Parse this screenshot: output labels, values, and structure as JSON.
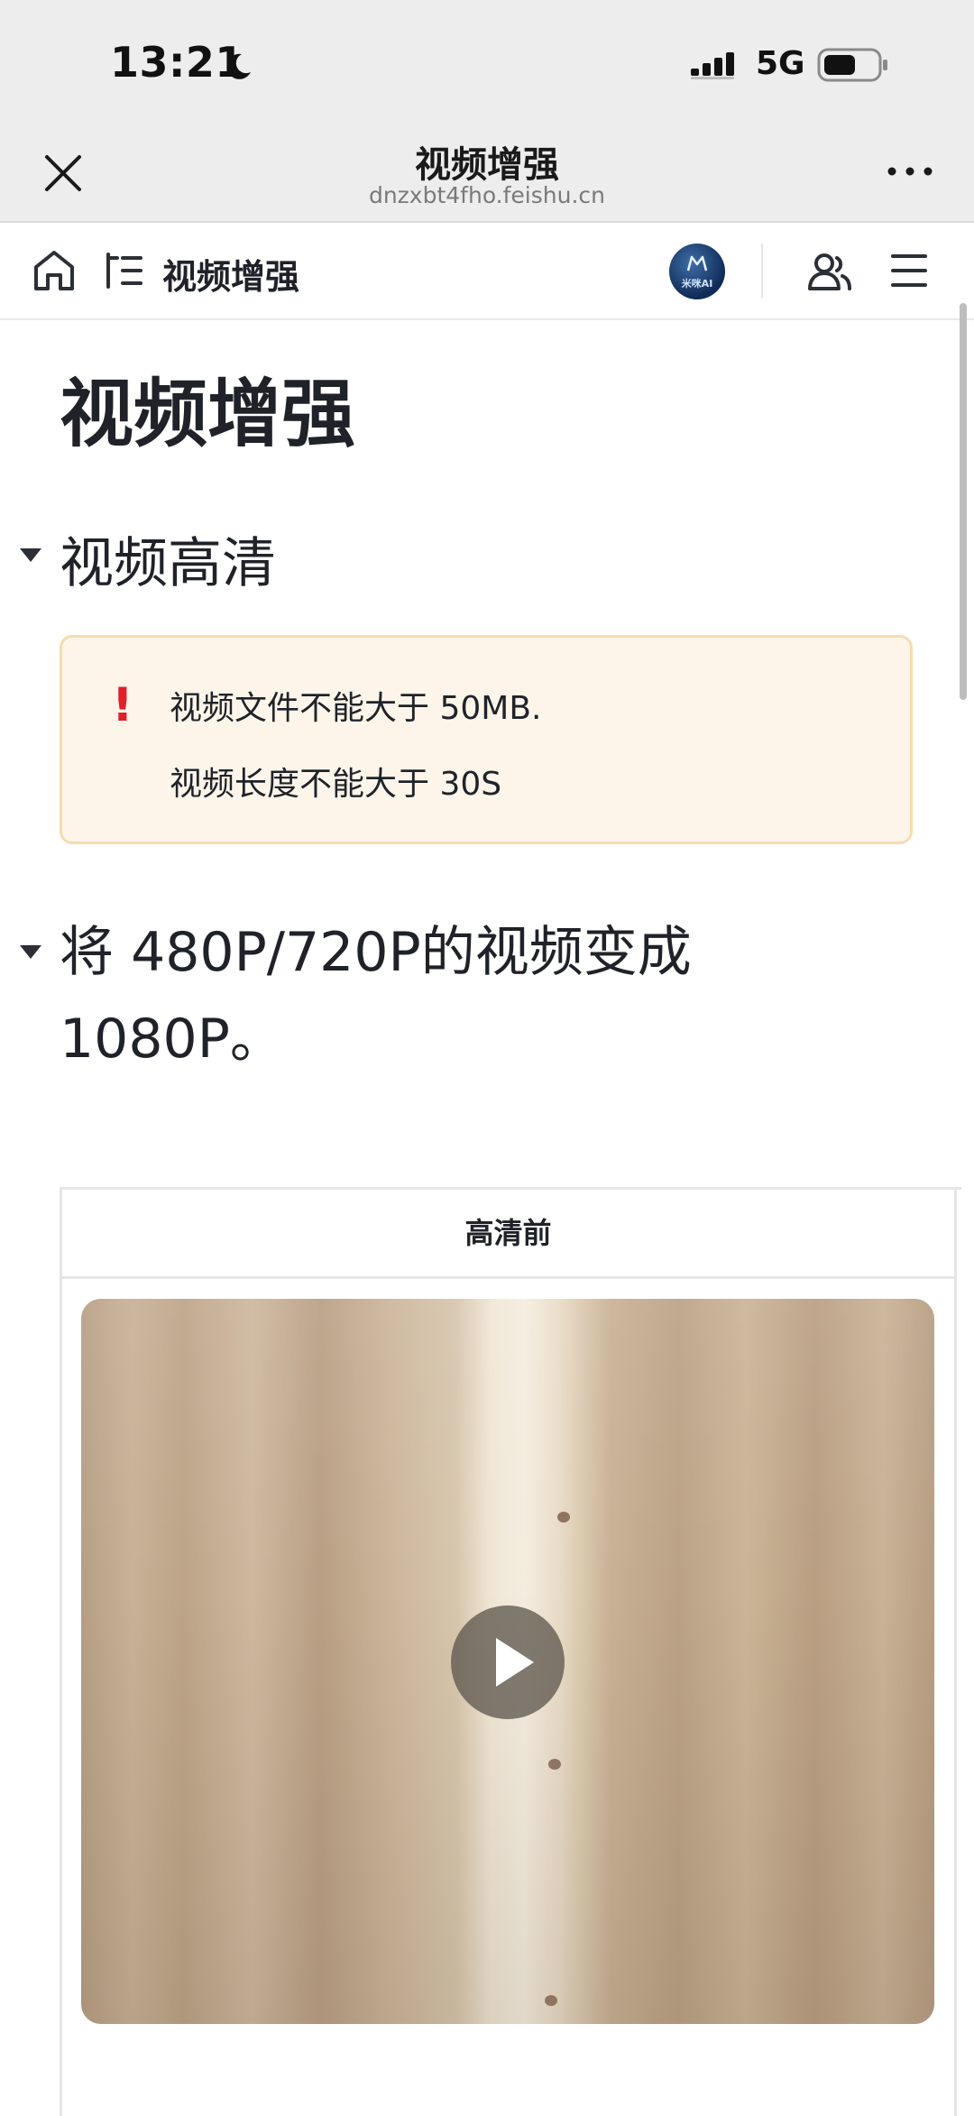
{
  "status_bar": {
    "time": "13:21",
    "network": "5G"
  },
  "browser": {
    "title": "视频增强",
    "url": "dnzxbt4fho.feishu.cn"
  },
  "toolbar": {
    "breadcrumb": "视频增强",
    "avatar_text": "米咪AI"
  },
  "doc": {
    "title": "视频增强",
    "section1": {
      "heading": "视频高清",
      "callout": {
        "icon": "!",
        "lines": [
          "视频文件不能大于 50MB.",
          "视频长度不能大于 30S"
        ]
      }
    },
    "section2": {
      "heading": "将 480P/720P的视频变成1080P。"
    },
    "table": {
      "header": "高清前"
    }
  },
  "colors": {
    "callout_bg": "#fef5ea",
    "callout_border": "#f7dcaf",
    "alert": "#e0202b"
  }
}
